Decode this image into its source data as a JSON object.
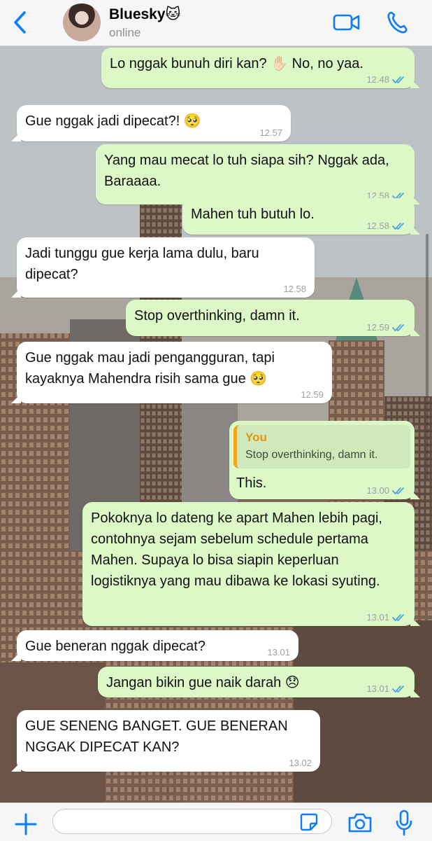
{
  "header": {
    "contact_name": "Bluesky",
    "contact_emoji": "🐱",
    "status": "online",
    "back_icon": "chevron-left-icon",
    "video_icon": "video-call-icon",
    "phone_icon": "phone-call-icon",
    "accent_color": "#0a7cff"
  },
  "messages": [
    {
      "dir": "out",
      "text": "Lo nggak bunuh diri kan? ✋🏻 No, no yaa.",
      "time": "12.48",
      "read": true
    },
    {
      "dir": "in",
      "text": "Gue nggak jadi dipecat?! 🥺",
      "time": "12.57"
    },
    {
      "dir": "out",
      "text": "Yang mau mecat lo tuh siapa sih? Nggak ada, Baraaaa.",
      "time": "12.58",
      "read": true
    },
    {
      "dir": "out",
      "text": "Mahen tuh butuh lo.",
      "time": "12.58",
      "read": true
    },
    {
      "dir": "in",
      "text": "Jadi tunggu gue kerja lama dulu, baru dipecat?",
      "time": "12.58"
    },
    {
      "dir": "out",
      "text": "Stop overthinking, damn it.",
      "time": "12.59",
      "read": true
    },
    {
      "dir": "in",
      "text": "Gue nggak mau jadi pengangguran, tapi kayaknya Mahendra risih sama gue 🥺",
      "time": "12.59"
    },
    {
      "dir": "out",
      "quote_name": "You",
      "quote_text": "Stop overthinking, damn it.",
      "text": "This.",
      "time": "13.00",
      "read": true
    },
    {
      "dir": "out",
      "text": "Pokoknya lo dateng ke apart Mahen lebih pagi, contohnya sejam sebelum schedule pertama Mahen. Supaya lo bisa siapin keperluan logistiknya yang mau dibawa ke lokasi syuting.",
      "time": "13.01",
      "read": true
    },
    {
      "dir": "in",
      "text": "Gue beneran nggak dipecat?",
      "time": "13.01"
    },
    {
      "dir": "out",
      "text": "Jangan bikin gue naik darah 😞",
      "time": "13.01",
      "read": true
    },
    {
      "dir": "in",
      "text": "GUE SENENG BANGET. GUE BENERAN NGGAK DIPECAT KAN?",
      "time": "13.02"
    }
  ],
  "composer": {
    "placeholder": "",
    "plus_icon": "plus-icon",
    "sticker_icon": "sticker-icon",
    "camera_icon": "camera-icon",
    "mic_icon": "microphone-icon"
  },
  "colors": {
    "outgoing_bubble": "#dcf8c6",
    "incoming_bubble": "#ffffff",
    "read_ticks": "#4fa3e0",
    "quote_accent": "#f2a51a"
  }
}
